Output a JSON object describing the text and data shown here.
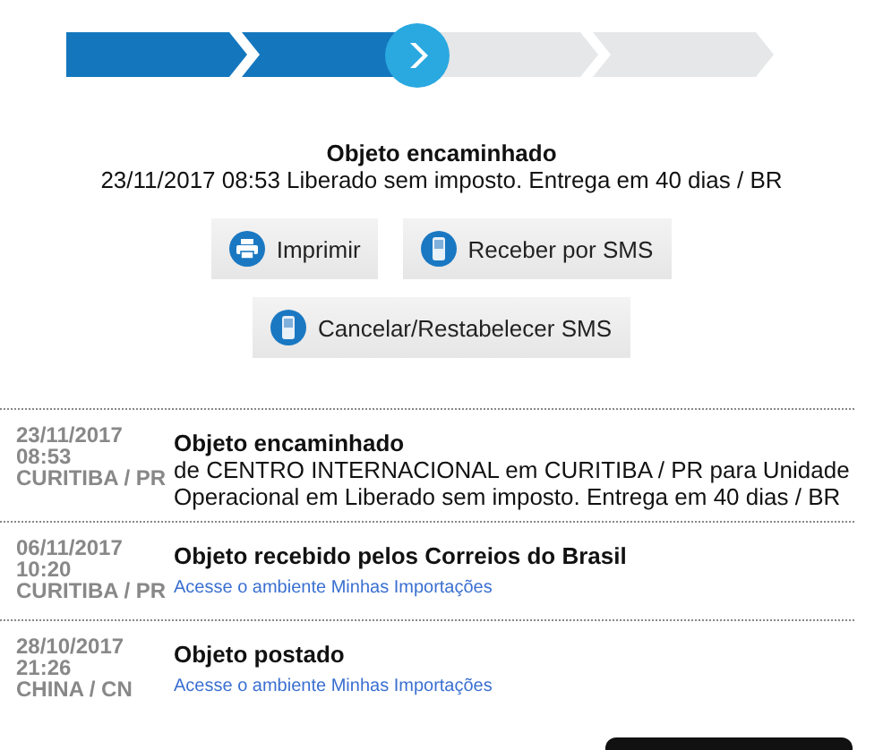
{
  "progress": {
    "steps": [
      {
        "completed": true,
        "current": false
      },
      {
        "completed": true,
        "current": false
      },
      {
        "completed": false,
        "current": true
      },
      {
        "completed": false,
        "current": false
      }
    ]
  },
  "status": {
    "title": "Objeto encaminhado",
    "detail": "23/11/2017 08:53 Liberado sem imposto. Entrega em 40 dias / BR"
  },
  "buttons": [
    {
      "label": "Imprimir",
      "kind": "printer"
    },
    {
      "label": "Receber por SMS",
      "kind": "phone"
    },
    {
      "label": "Cancelar/Restabelecer SMS",
      "kind": "phone"
    }
  ],
  "events": [
    {
      "date": "23/11/2017",
      "time": "08:53",
      "place": "CURITIBA / PR",
      "title": "Objeto encaminhado",
      "description": "de CENTRO INTERNACIONAL em CURITIBA / PR para Unidade Operacional em Liberado sem imposto. Entrega em 40 dias / BR"
    },
    {
      "date": "06/11/2017",
      "time": "10:20",
      "place": "CURITIBA / PR",
      "title": "Objeto recebido pelos Correios do Brasil",
      "link": "Acesse o ambiente Minhas Importações"
    },
    {
      "date": "28/10/2017",
      "time": "21:26",
      "place": "CHINA / CN",
      "title": "Objeto postado",
      "link": "Acesse o ambiente Minhas Importações"
    }
  ]
}
